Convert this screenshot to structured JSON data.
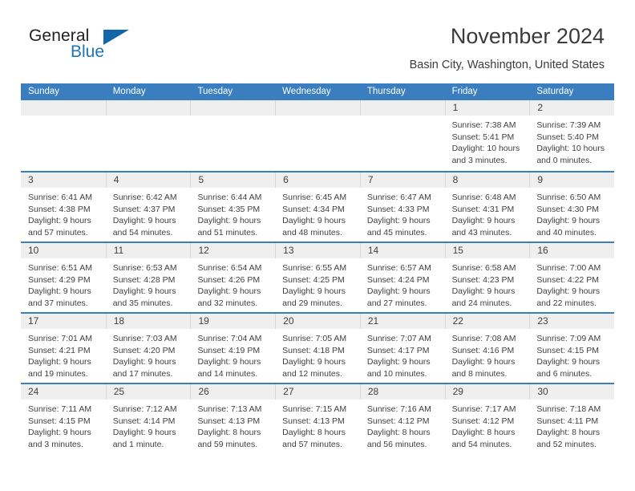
{
  "brand": {
    "name_part1": "General",
    "name_part2": "Blue",
    "logo_icon": "triangle-flag-icon",
    "accent_color": "#1c75bc"
  },
  "header": {
    "title": "November 2024",
    "subtitle": "Basin City, Washington, United States"
  },
  "calendar": {
    "header_color": "#3a7ebf",
    "weekdays": [
      "Sunday",
      "Monday",
      "Tuesday",
      "Wednesday",
      "Thursday",
      "Friday",
      "Saturday"
    ],
    "weeks": [
      [
        {
          "day": "",
          "empty": true
        },
        {
          "day": "",
          "empty": true
        },
        {
          "day": "",
          "empty": true
        },
        {
          "day": "",
          "empty": true
        },
        {
          "day": "",
          "empty": true
        },
        {
          "day": "1",
          "sunrise": "Sunrise: 7:38 AM",
          "sunset": "Sunset: 5:41 PM",
          "daylight1": "Daylight: 10 hours",
          "daylight2": "and 3 minutes."
        },
        {
          "day": "2",
          "sunrise": "Sunrise: 7:39 AM",
          "sunset": "Sunset: 5:40 PM",
          "daylight1": "Daylight: 10 hours",
          "daylight2": "and 0 minutes."
        }
      ],
      [
        {
          "day": "3",
          "sunrise": "Sunrise: 6:41 AM",
          "sunset": "Sunset: 4:38 PM",
          "daylight1": "Daylight: 9 hours",
          "daylight2": "and 57 minutes."
        },
        {
          "day": "4",
          "sunrise": "Sunrise: 6:42 AM",
          "sunset": "Sunset: 4:37 PM",
          "daylight1": "Daylight: 9 hours",
          "daylight2": "and 54 minutes."
        },
        {
          "day": "5",
          "sunrise": "Sunrise: 6:44 AM",
          "sunset": "Sunset: 4:35 PM",
          "daylight1": "Daylight: 9 hours",
          "daylight2": "and 51 minutes."
        },
        {
          "day": "6",
          "sunrise": "Sunrise: 6:45 AM",
          "sunset": "Sunset: 4:34 PM",
          "daylight1": "Daylight: 9 hours",
          "daylight2": "and 48 minutes."
        },
        {
          "day": "7",
          "sunrise": "Sunrise: 6:47 AM",
          "sunset": "Sunset: 4:33 PM",
          "daylight1": "Daylight: 9 hours",
          "daylight2": "and 45 minutes."
        },
        {
          "day": "8",
          "sunrise": "Sunrise: 6:48 AM",
          "sunset": "Sunset: 4:31 PM",
          "daylight1": "Daylight: 9 hours",
          "daylight2": "and 43 minutes."
        },
        {
          "day": "9",
          "sunrise": "Sunrise: 6:50 AM",
          "sunset": "Sunset: 4:30 PM",
          "daylight1": "Daylight: 9 hours",
          "daylight2": "and 40 minutes."
        }
      ],
      [
        {
          "day": "10",
          "sunrise": "Sunrise: 6:51 AM",
          "sunset": "Sunset: 4:29 PM",
          "daylight1": "Daylight: 9 hours",
          "daylight2": "and 37 minutes."
        },
        {
          "day": "11",
          "sunrise": "Sunrise: 6:53 AM",
          "sunset": "Sunset: 4:28 PM",
          "daylight1": "Daylight: 9 hours",
          "daylight2": "and 35 minutes."
        },
        {
          "day": "12",
          "sunrise": "Sunrise: 6:54 AM",
          "sunset": "Sunset: 4:26 PM",
          "daylight1": "Daylight: 9 hours",
          "daylight2": "and 32 minutes."
        },
        {
          "day": "13",
          "sunrise": "Sunrise: 6:55 AM",
          "sunset": "Sunset: 4:25 PM",
          "daylight1": "Daylight: 9 hours",
          "daylight2": "and 29 minutes."
        },
        {
          "day": "14",
          "sunrise": "Sunrise: 6:57 AM",
          "sunset": "Sunset: 4:24 PM",
          "daylight1": "Daylight: 9 hours",
          "daylight2": "and 27 minutes."
        },
        {
          "day": "15",
          "sunrise": "Sunrise: 6:58 AM",
          "sunset": "Sunset: 4:23 PM",
          "daylight1": "Daylight: 9 hours",
          "daylight2": "and 24 minutes."
        },
        {
          "day": "16",
          "sunrise": "Sunrise: 7:00 AM",
          "sunset": "Sunset: 4:22 PM",
          "daylight1": "Daylight: 9 hours",
          "daylight2": "and 22 minutes."
        }
      ],
      [
        {
          "day": "17",
          "sunrise": "Sunrise: 7:01 AM",
          "sunset": "Sunset: 4:21 PM",
          "daylight1": "Daylight: 9 hours",
          "daylight2": "and 19 minutes."
        },
        {
          "day": "18",
          "sunrise": "Sunrise: 7:03 AM",
          "sunset": "Sunset: 4:20 PM",
          "daylight1": "Daylight: 9 hours",
          "daylight2": "and 17 minutes."
        },
        {
          "day": "19",
          "sunrise": "Sunrise: 7:04 AM",
          "sunset": "Sunset: 4:19 PM",
          "daylight1": "Daylight: 9 hours",
          "daylight2": "and 14 minutes."
        },
        {
          "day": "20",
          "sunrise": "Sunrise: 7:05 AM",
          "sunset": "Sunset: 4:18 PM",
          "daylight1": "Daylight: 9 hours",
          "daylight2": "and 12 minutes."
        },
        {
          "day": "21",
          "sunrise": "Sunrise: 7:07 AM",
          "sunset": "Sunset: 4:17 PM",
          "daylight1": "Daylight: 9 hours",
          "daylight2": "and 10 minutes."
        },
        {
          "day": "22",
          "sunrise": "Sunrise: 7:08 AM",
          "sunset": "Sunset: 4:16 PM",
          "daylight1": "Daylight: 9 hours",
          "daylight2": "and 8 minutes."
        },
        {
          "day": "23",
          "sunrise": "Sunrise: 7:09 AM",
          "sunset": "Sunset: 4:15 PM",
          "daylight1": "Daylight: 9 hours",
          "daylight2": "and 6 minutes."
        }
      ],
      [
        {
          "day": "24",
          "sunrise": "Sunrise: 7:11 AM",
          "sunset": "Sunset: 4:15 PM",
          "daylight1": "Daylight: 9 hours",
          "daylight2": "and 3 minutes."
        },
        {
          "day": "25",
          "sunrise": "Sunrise: 7:12 AM",
          "sunset": "Sunset: 4:14 PM",
          "daylight1": "Daylight: 9 hours",
          "daylight2": "and 1 minute."
        },
        {
          "day": "26",
          "sunrise": "Sunrise: 7:13 AM",
          "sunset": "Sunset: 4:13 PM",
          "daylight1": "Daylight: 8 hours",
          "daylight2": "and 59 minutes."
        },
        {
          "day": "27",
          "sunrise": "Sunrise: 7:15 AM",
          "sunset": "Sunset: 4:13 PM",
          "daylight1": "Daylight: 8 hours",
          "daylight2": "and 57 minutes."
        },
        {
          "day": "28",
          "sunrise": "Sunrise: 7:16 AM",
          "sunset": "Sunset: 4:12 PM",
          "daylight1": "Daylight: 8 hours",
          "daylight2": "and 56 minutes."
        },
        {
          "day": "29",
          "sunrise": "Sunrise: 7:17 AM",
          "sunset": "Sunset: 4:12 PM",
          "daylight1": "Daylight: 8 hours",
          "daylight2": "and 54 minutes."
        },
        {
          "day": "30",
          "sunrise": "Sunrise: 7:18 AM",
          "sunset": "Sunset: 4:11 PM",
          "daylight1": "Daylight: 8 hours",
          "daylight2": "and 52 minutes."
        }
      ]
    ]
  }
}
